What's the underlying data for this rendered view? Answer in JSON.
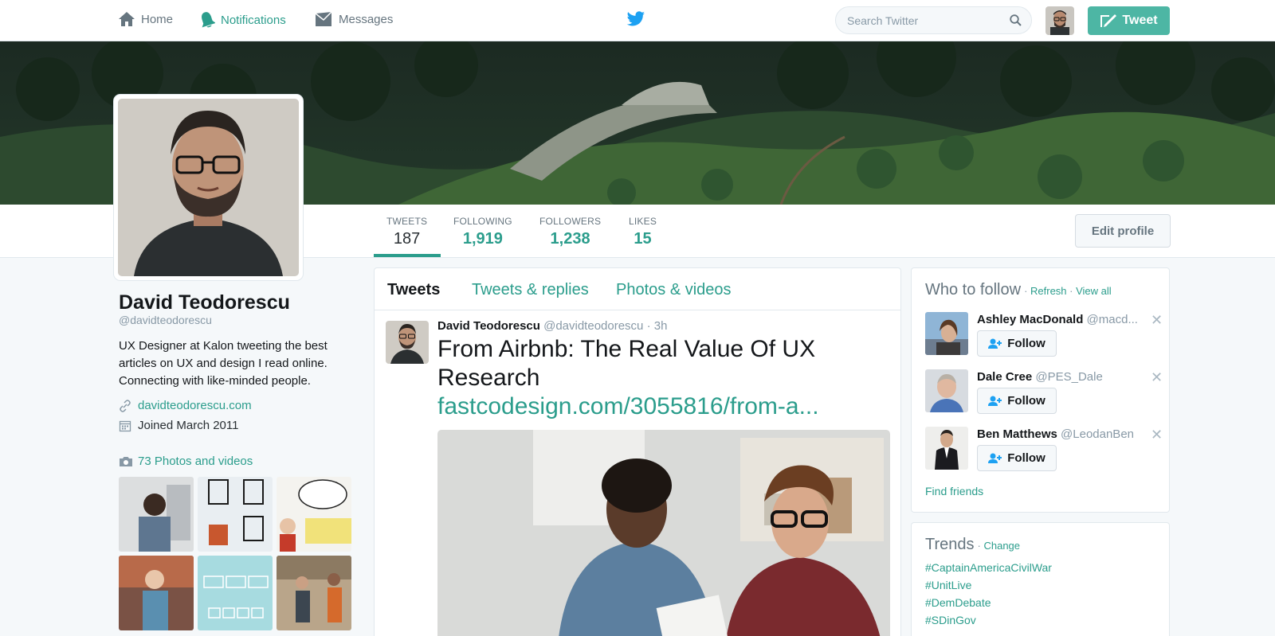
{
  "nav": {
    "home": "Home",
    "notifications": "Notifications",
    "messages": "Messages",
    "search_placeholder": "Search Twitter",
    "tweet_button": "Tweet"
  },
  "profile": {
    "name": "David Teodorescu",
    "handle": "@davidteodorescu",
    "bio": "UX Designer at Kalon tweeting the best articles on UX and design I read online. Connecting with like-minded people.",
    "website": "davidteodorescu.com",
    "joined": "Joined March 2011",
    "photos_label": "73 Photos and videos",
    "edit_button": "Edit profile"
  },
  "stats": [
    {
      "label": "TWEETS",
      "value": "187"
    },
    {
      "label": "FOLLOWING",
      "value": "1,919"
    },
    {
      "label": "FOLLOWERS",
      "value": "1,238"
    },
    {
      "label": "LIKES",
      "value": "15"
    }
  ],
  "tabs": [
    "Tweets",
    "Tweets & replies",
    "Photos & videos"
  ],
  "tweet": {
    "name": "David Teodorescu",
    "handle": "@davidteodorescu",
    "time": "· 3h",
    "text": "From Airbnb: The Real Value Of UX Research",
    "link": "fastcodesign.com/3055816/from-a..."
  },
  "who_to_follow": {
    "title": "Who to follow",
    "refresh": "Refresh",
    "view_all": "View all",
    "follow_label": "Follow",
    "find_friends": "Find friends",
    "users": [
      {
        "name": "Ashley MacDonald",
        "handle": "@macd..."
      },
      {
        "name": "Dale Cree",
        "handle": "@PES_Dale"
      },
      {
        "name": "Ben Matthews",
        "handle": "@LeodanBen"
      }
    ]
  },
  "trends": {
    "title": "Trends",
    "change": "Change",
    "items": [
      "#CaptainAmericaCivilWar",
      "#UnitLive",
      "#DemDebate",
      "#SDinGov"
    ]
  },
  "colors": {
    "accent": "#2b9d8c",
    "tweet_button": "#4db6a4"
  }
}
